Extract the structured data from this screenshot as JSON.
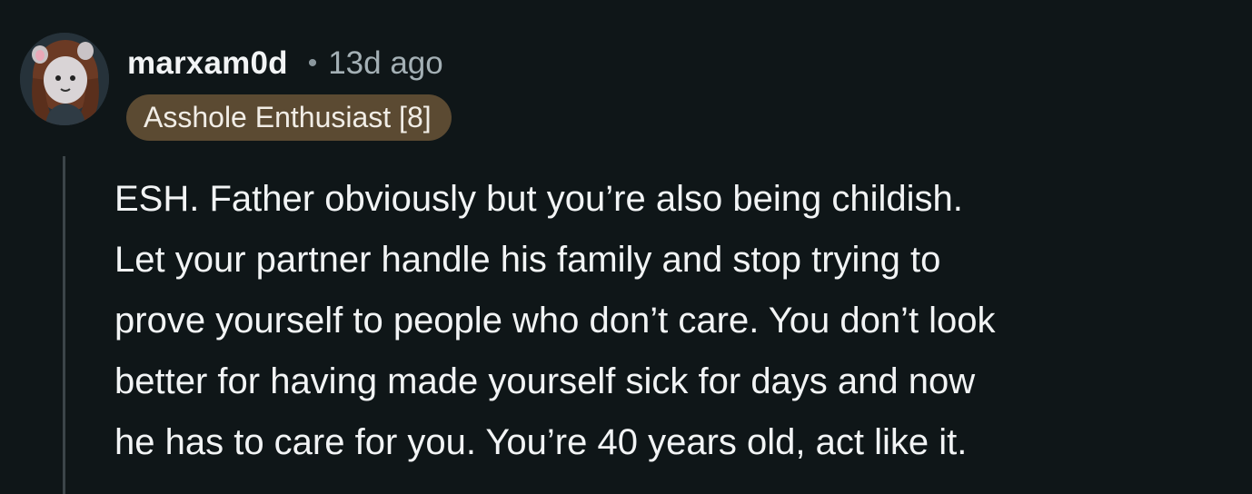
{
  "comment": {
    "username": "marxam0d",
    "separator": "•",
    "timestamp": "13d ago",
    "flair": "Asshole Enthusiast [8]",
    "body_lines": [
      "ESH. Father obviously but you’re also being childish.",
      "Let your partner handle his family and stop trying to",
      "prove yourself to people who don’t care. You don’t look",
      "better for having made yourself sick for days and now",
      "he has to care for you. You’re 40 years old, act like it."
    ]
  },
  "colors": {
    "background": "#0f1618",
    "flair_background": "#5b4a32",
    "thread_line": "#3c4549",
    "muted_text": "#a4b0b5"
  },
  "icons": {
    "avatar": "avatar-icon"
  }
}
